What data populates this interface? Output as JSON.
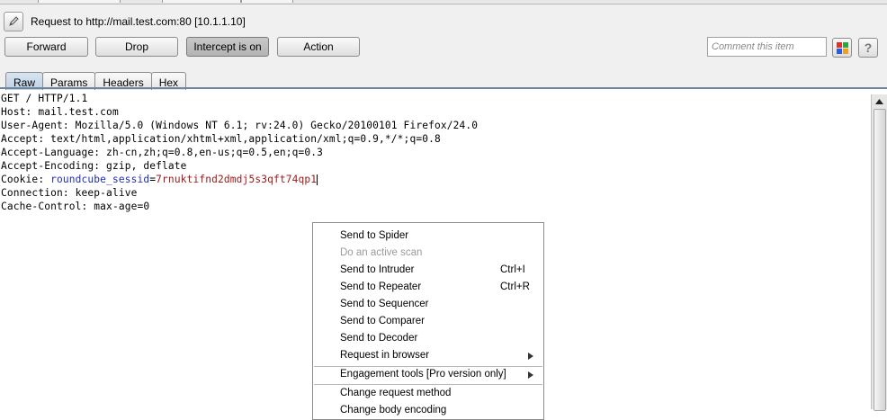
{
  "request_header": {
    "text": "Request to http://mail.test.com:80  [10.1.1.10]"
  },
  "toolbar": {
    "forward": "Forward",
    "drop": "Drop",
    "intercept": "Intercept is on",
    "action": "Action",
    "comment_placeholder": "Comment this item",
    "help": "?"
  },
  "colors": {
    "swatch_red": "#e0302b",
    "swatch_green": "#2aa83a",
    "swatch_blue": "#2a5fd8",
    "swatch_orange": "#f0a020",
    "cookie_name": "#1f2bb5",
    "cookie_value": "#a21818",
    "active_tab": "#bccfe2"
  },
  "tabs": [
    {
      "label": "Raw"
    },
    {
      "label": "Params"
    },
    {
      "label": "Headers"
    },
    {
      "label": "Hex"
    }
  ],
  "request_lines": {
    "line1": "GET / HTTP/1.1",
    "line2": "Host: mail.test.com",
    "line3": "User-Agent: Mozilla/5.0 (Windows NT 6.1; rv:24.0) Gecko/20100101 Firefox/24.0",
    "line4": "Accept: text/html,application/xhtml+xml,application/xml;q=0.9,*/*;q=0.8",
    "line5": "Accept-Language: zh-cn,zh;q=0.8,en-us;q=0.5,en;q=0.3",
    "line6": "Accept-Encoding: gzip, deflate",
    "cookie_prefix": "Cookie: ",
    "cookie_name": "roundcube_sessid",
    "cookie_eq": "=",
    "cookie_value": "7rnuktifnd2dmdj5s3qft74qp1",
    "line8": "Connection: keep-alive",
    "line9": "Cache-Control: max-age=0"
  },
  "context_menu": {
    "items": [
      {
        "label": "Send to Spider",
        "shortcut": "",
        "disabled": false
      },
      {
        "label": "Do an active scan",
        "shortcut": "",
        "disabled": true
      },
      {
        "label": "Send to Intruder",
        "shortcut": "Ctrl+I",
        "disabled": false
      },
      {
        "label": "Send to Repeater",
        "shortcut": "Ctrl+R",
        "disabled": false
      },
      {
        "label": "Send to Sequencer",
        "shortcut": "",
        "disabled": false
      },
      {
        "label": "Send to Comparer",
        "shortcut": "",
        "disabled": false
      },
      {
        "label": "Send to Decoder",
        "shortcut": "",
        "disabled": false
      },
      {
        "label": "Request in browser",
        "shortcut": "",
        "disabled": false
      },
      {
        "label": "Engagement tools [Pro version only]",
        "shortcut": "",
        "disabled": false
      },
      {
        "label": "Change request method",
        "shortcut": "",
        "disabled": false
      },
      {
        "label": "Change body encoding",
        "shortcut": "",
        "disabled": false
      }
    ]
  }
}
